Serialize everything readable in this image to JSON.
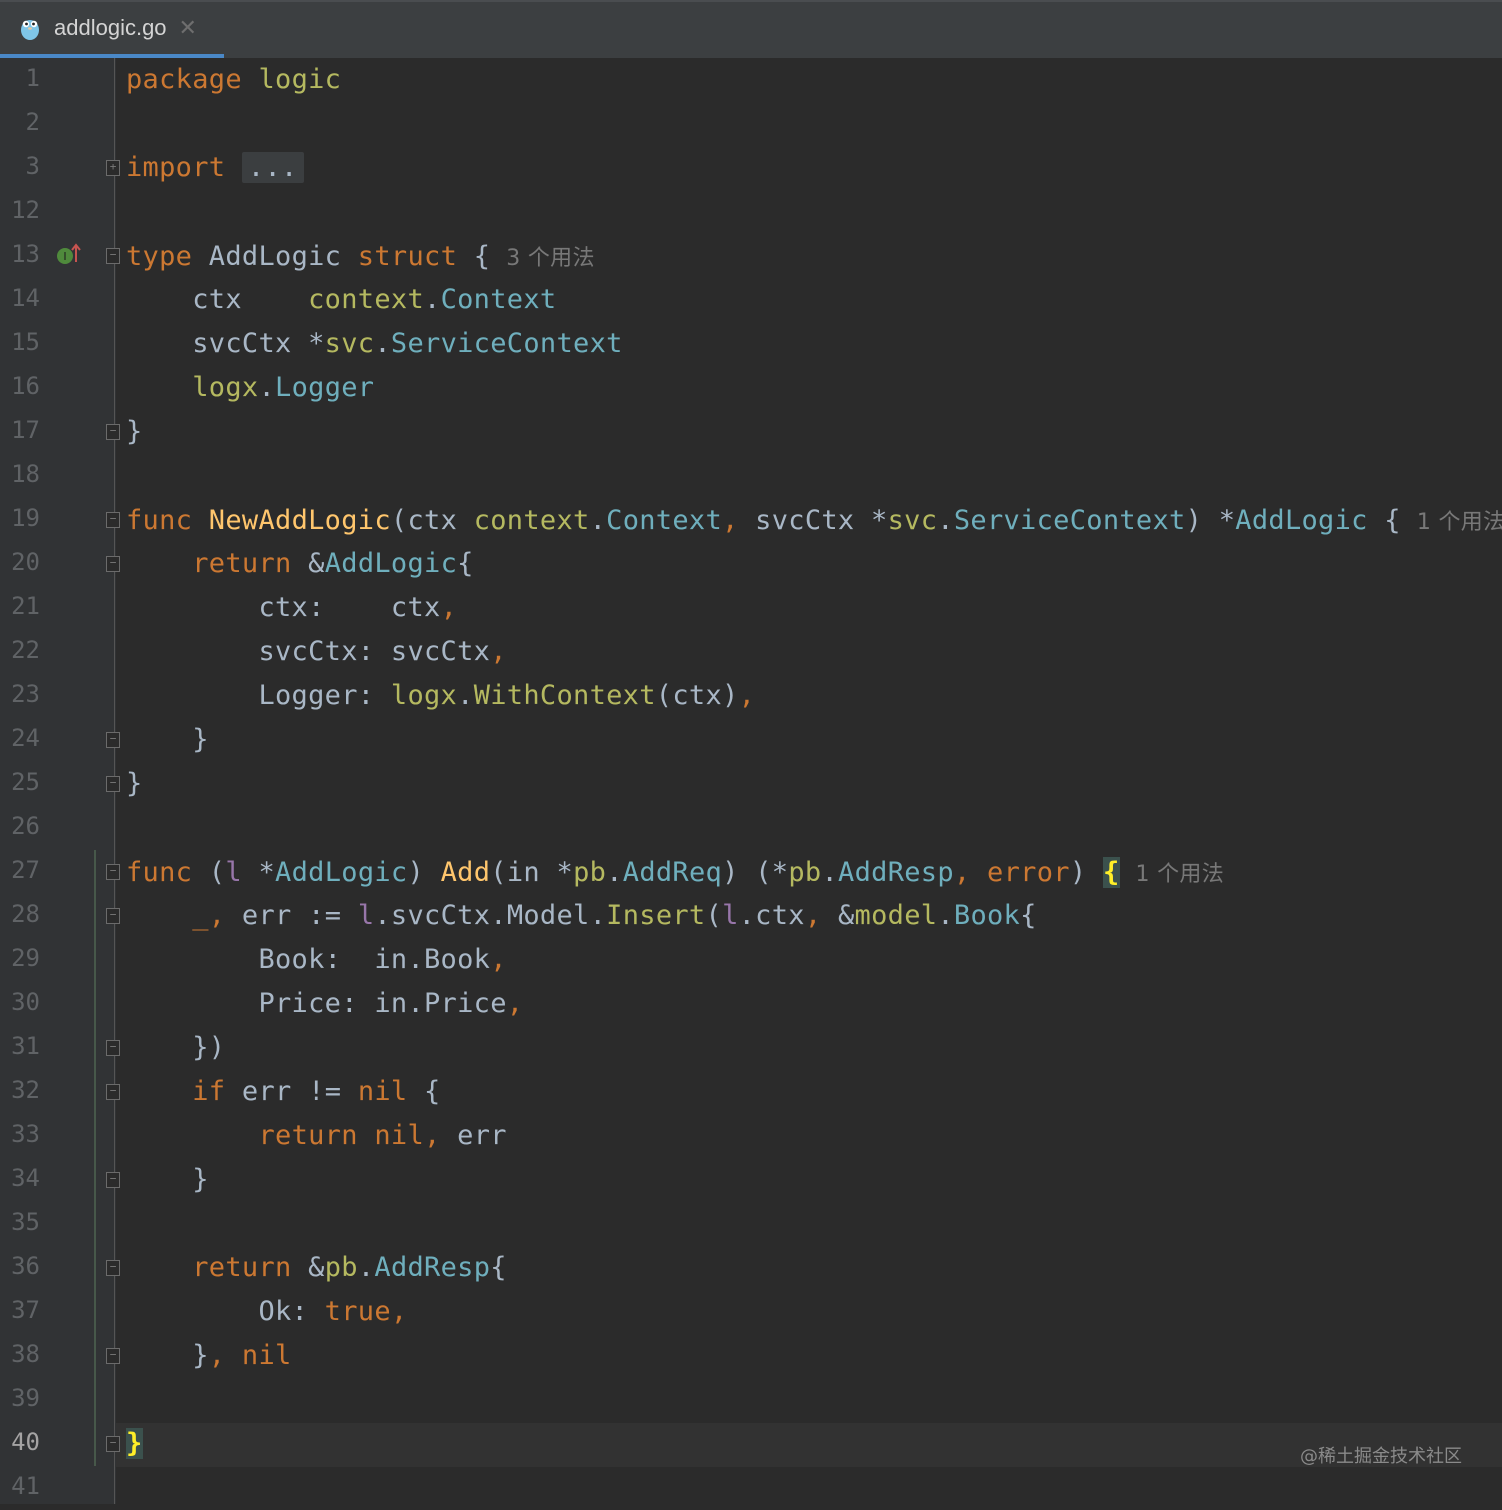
{
  "tab": {
    "filename": "addlogic.go",
    "close": "✕"
  },
  "lines": [
    {
      "n": "1",
      "html": "<span class=\"kw\">package</span> <span class=\"pkg\">logic</span>"
    },
    {
      "n": "2",
      "html": ""
    },
    {
      "n": "3",
      "html": "<span class=\"kw\">import</span> <span class=\"fold-dots\">...</span>"
    },
    {
      "n": "12",
      "html": ""
    },
    {
      "n": "13",
      "html": "<span class=\"kw\">type</span> AddLogic <span class=\"kw\">struct</span> {<span class=\"hint\">3 个用法</span>"
    },
    {
      "n": "14",
      "html": "    ctx    <span class=\"pkg\">context</span>.<span class=\"type\">Context</span>"
    },
    {
      "n": "15",
      "html": "    svcCtx *<span class=\"pkg\">svc</span>.<span class=\"type\">ServiceContext</span>"
    },
    {
      "n": "16",
      "html": "    <span class=\"pkg\">logx</span>.<span class=\"type\">Logger</span>"
    },
    {
      "n": "17",
      "html": "}"
    },
    {
      "n": "18",
      "html": ""
    },
    {
      "n": "19",
      "html": "<span class=\"kw\">func</span> <span class=\"fn\">NewAddLogic</span>(ctx <span class=\"pkg\">context</span>.<span class=\"type\">Context</span><span class=\"kw\">,</span> svcCtx *<span class=\"pkg\">svc</span>.<span class=\"type\">ServiceContext</span>) *<span class=\"type\">AddLogic</span> {<span class=\"hint\">1 个用法</span>"
    },
    {
      "n": "20",
      "html": "    <span class=\"kw\">return</span> &amp;<span class=\"type\">AddLogic</span>{"
    },
    {
      "n": "21",
      "html": "        ctx:    ctx<span class=\"kw\">,</span>"
    },
    {
      "n": "22",
      "html": "        svcCtx: svcCtx<span class=\"kw\">,</span>"
    },
    {
      "n": "23",
      "html": "        Logger: <span class=\"pkg\">logx</span>.<span class=\"fn\" style=\"color:#b5b960\">WithContext</span>(ctx)<span class=\"kw\">,</span>"
    },
    {
      "n": "24",
      "html": "    }"
    },
    {
      "n": "25",
      "html": "}"
    },
    {
      "n": "26",
      "html": ""
    },
    {
      "n": "27",
      "html": "<span class=\"kw\">func</span> (<span class=\"type\" style=\"color:#9876aa\">l</span> *<span class=\"type\">AddLogic</span>) <span class=\"fn\">Add</span>(in *<span class=\"pkg\">pb</span>.<span class=\"type\">AddReq</span>) (*<span class=\"pkg\">pb</span>.<span class=\"type\">AddResp</span><span class=\"kw\">,</span> <span class=\"kw\">error</span>) <span class=\"brace-hl\">{</span><span class=\"hint\">1 个用法</span>"
    },
    {
      "n": "28",
      "html": "    <span class=\"kw\">_,</span> err := <span style=\"color:#9876aa\">l</span>.svcCtx.Model.<span class=\"fn\" style=\"color:#b5b960\">Insert</span>(<span style=\"color:#9876aa\">l</span>.ctx<span class=\"kw\">,</span> &amp;<span class=\"pkg\">model</span>.<span class=\"type\">Book</span>{"
    },
    {
      "n": "29",
      "html": "        Book:  in.Book<span class=\"kw\">,</span>"
    },
    {
      "n": "30",
      "html": "        Price: in.Price<span class=\"kw\">,</span>"
    },
    {
      "n": "31",
      "html": "    })"
    },
    {
      "n": "32",
      "html": "    <span class=\"kw\">if</span> err != <span class=\"kw\">nil</span> {"
    },
    {
      "n": "33",
      "html": "        <span class=\"kw\">return</span> <span class=\"kw\">nil,</span> err"
    },
    {
      "n": "34",
      "html": "    }"
    },
    {
      "n": "35",
      "html": ""
    },
    {
      "n": "36",
      "html": "    <span class=\"kw\">return</span> &amp;<span class=\"pkg\">pb</span>.<span class=\"type\">AddResp</span>{"
    },
    {
      "n": "37",
      "html": "        Ok: <span class=\"kw\">true,</span>"
    },
    {
      "n": "38",
      "html": "    }<span class=\"kw\">,</span> <span class=\"kw\">nil</span>"
    },
    {
      "n": "39",
      "html": ""
    },
    {
      "n": "40",
      "html": "<span class=\"brace-hl\">}</span>"
    },
    {
      "n": "41",
      "html": ""
    }
  ],
  "watermark": "@稀土掘金技术社区"
}
